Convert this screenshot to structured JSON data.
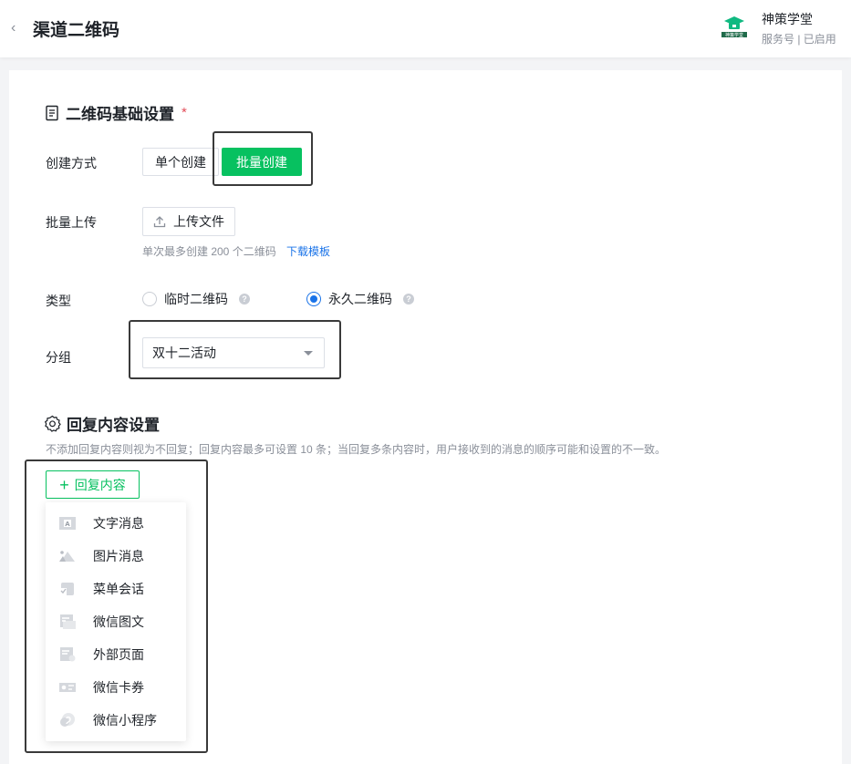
{
  "header": {
    "back_icon": "chevron-left-icon",
    "title": "渠道二维码",
    "account": {
      "name": "神策学堂",
      "status": "服务号 | 已启用",
      "logo_text": "神策学堂"
    }
  },
  "basic_settings": {
    "title": "二维码基础设置",
    "required_mark": "*",
    "create_mode": {
      "label": "创建方式",
      "options": [
        "单个创建",
        "批量创建"
      ],
      "selected": "批量创建"
    },
    "batch_upload": {
      "label": "批量上传",
      "button": "上传文件",
      "hint": "单次最多创建 200 个二维码",
      "link": "下载模板"
    },
    "type": {
      "label": "类型",
      "options": [
        "临时二维码",
        "永久二维码"
      ],
      "selected": "永久二维码"
    },
    "group": {
      "label": "分组",
      "value": "双十二活动"
    }
  },
  "reply_settings": {
    "title": "回复内容设置",
    "description": "不添加回复内容则视为不回复；回复内容最多可设置 10 条；当回复多条内容时，用户接收到的消息的顺序可能和设置的不一致。",
    "add_button": "回复内容",
    "menu": [
      {
        "label": "文字消息",
        "icon": "text-message-icon"
      },
      {
        "label": "图片消息",
        "icon": "image-message-icon"
      },
      {
        "label": "菜单会话",
        "icon": "menu-session-icon"
      },
      {
        "label": "微信图文",
        "icon": "wechat-article-icon"
      },
      {
        "label": "外部页面",
        "icon": "external-page-icon"
      },
      {
        "label": "微信卡券",
        "icon": "wechat-coupon-icon"
      },
      {
        "label": "微信小程序",
        "icon": "mini-program-icon"
      }
    ]
  },
  "colors": {
    "accent": "#07c160",
    "link": "#1a73e8",
    "required": "#e34d59"
  }
}
